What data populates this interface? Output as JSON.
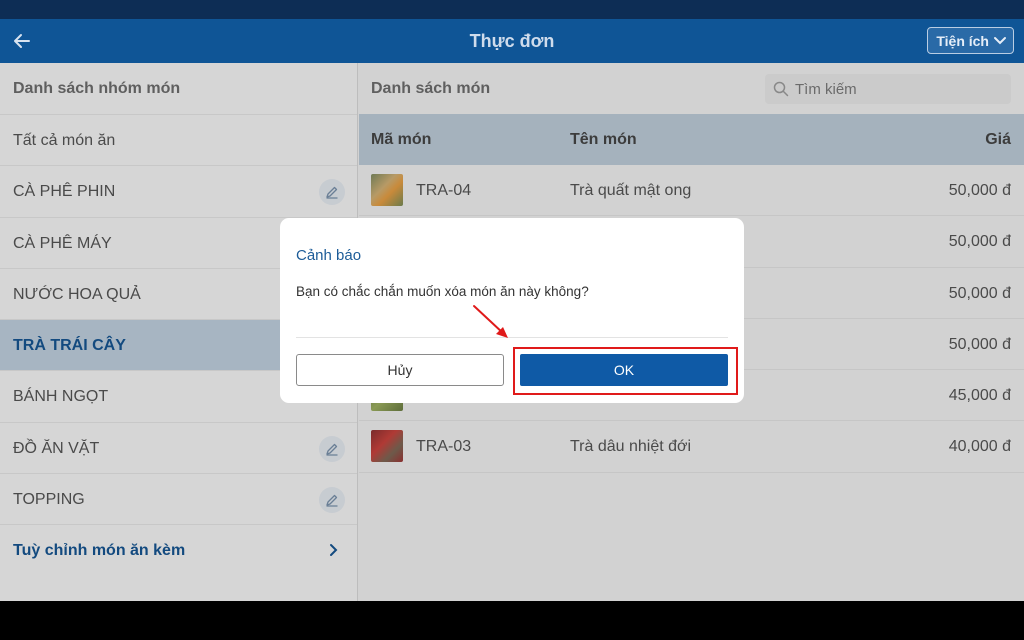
{
  "app": {
    "title": "Thực đơn",
    "back_icon": "arrow-left-icon",
    "tools_label": "Tiện ích",
    "tools_icon": "chevron-down-icon"
  },
  "colors": {
    "app_bar": "#0f5596",
    "accent": "#134a7f",
    "ok_button": "#0f5aa6",
    "highlight": "#e01a1a"
  },
  "sidebar": {
    "header": "Danh sách nhóm món",
    "items": [
      {
        "label": "Tất cả món ăn"
      },
      {
        "label": "CÀ PHÊ PHIN",
        "icon": "pencil-icon"
      },
      {
        "label": "CÀ PHÊ MÁY"
      },
      {
        "label": "NƯỚC HOA QUẢ"
      },
      {
        "label": "TRÀ TRÁI CÂY",
        "selected": true
      },
      {
        "label": "BÁNH NGỌT"
      },
      {
        "label": "ĐỒ ĂN VẶT",
        "icon": "pencil-icon"
      },
      {
        "label": "TOPPING",
        "icon": "pencil-icon"
      }
    ],
    "footer_link": "Tuỳ chỉnh món ăn kèm",
    "footer_icon": "chevron-right-icon"
  },
  "main": {
    "header": "Danh sách món",
    "search": {
      "placeholder": "Tìm kiếm",
      "icon": "search-icon"
    },
    "columns": {
      "code": "Mã món",
      "name": "Tên món",
      "price": "Giá"
    },
    "rows": [
      {
        "code": "TRA-04",
        "name": "Trà quất mật ong",
        "price": "50,000 đ"
      },
      {
        "code": "",
        "name": "",
        "price": "50,000 đ"
      },
      {
        "code": "",
        "name": "",
        "price": "50,000 đ"
      },
      {
        "code": "",
        "name": "",
        "price": "50,000 đ"
      },
      {
        "code": "",
        "name": "",
        "price": "45,000 đ"
      },
      {
        "code": "TRA-03",
        "name": "Trà dâu nhiệt đới",
        "price": "40,000 đ"
      }
    ]
  },
  "dialog": {
    "title": "Cảnh báo",
    "message": "Bạn có chắc chắn muốn xóa món ăn này không?",
    "cancel_label": "Hủy",
    "ok_label": "OK"
  }
}
